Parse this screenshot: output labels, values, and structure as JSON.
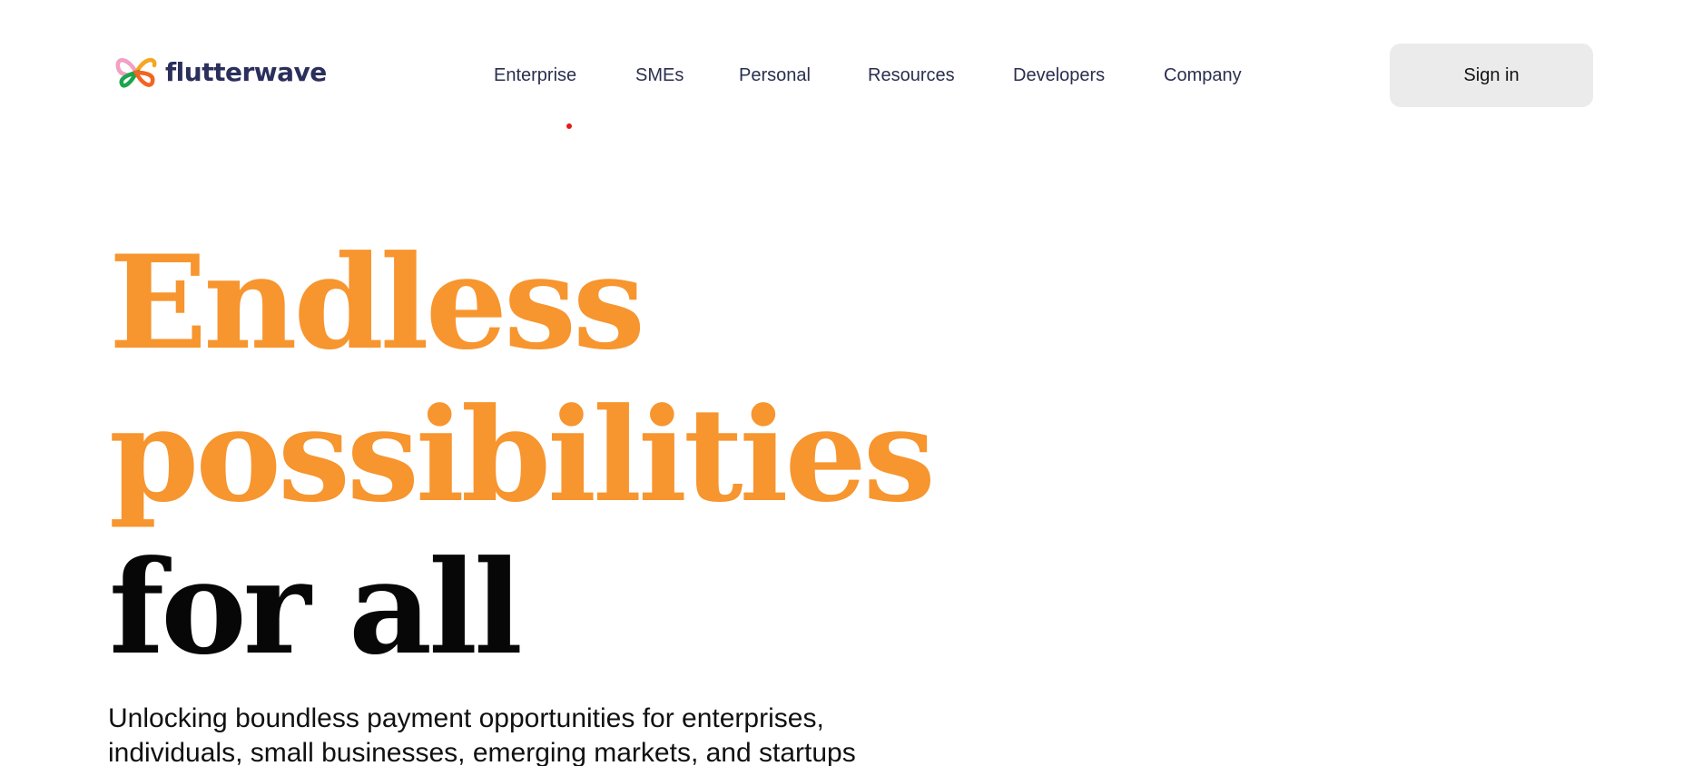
{
  "brand": {
    "name": "flutterwave",
    "icon": "flutterwave-butterfly-icon",
    "text_color": "#2a2f5c"
  },
  "nav": {
    "items": [
      {
        "label": "Enterprise"
      },
      {
        "label": "SMEs"
      },
      {
        "label": "Personal"
      },
      {
        "label": "Resources"
      },
      {
        "label": "Developers"
      },
      {
        "label": "Company"
      }
    ]
  },
  "header": {
    "signin_label": "Sign in"
  },
  "hero": {
    "line1": "Endless",
    "line2": "possibilities",
    "line3": "for all",
    "accent_color": "#f7952f",
    "text_color": "#070707"
  },
  "subtitle": {
    "line1": "Unlocking boundless payment opportunities for enterprises,",
    "line2": "individuals, small businesses, emerging markets, and startups"
  }
}
